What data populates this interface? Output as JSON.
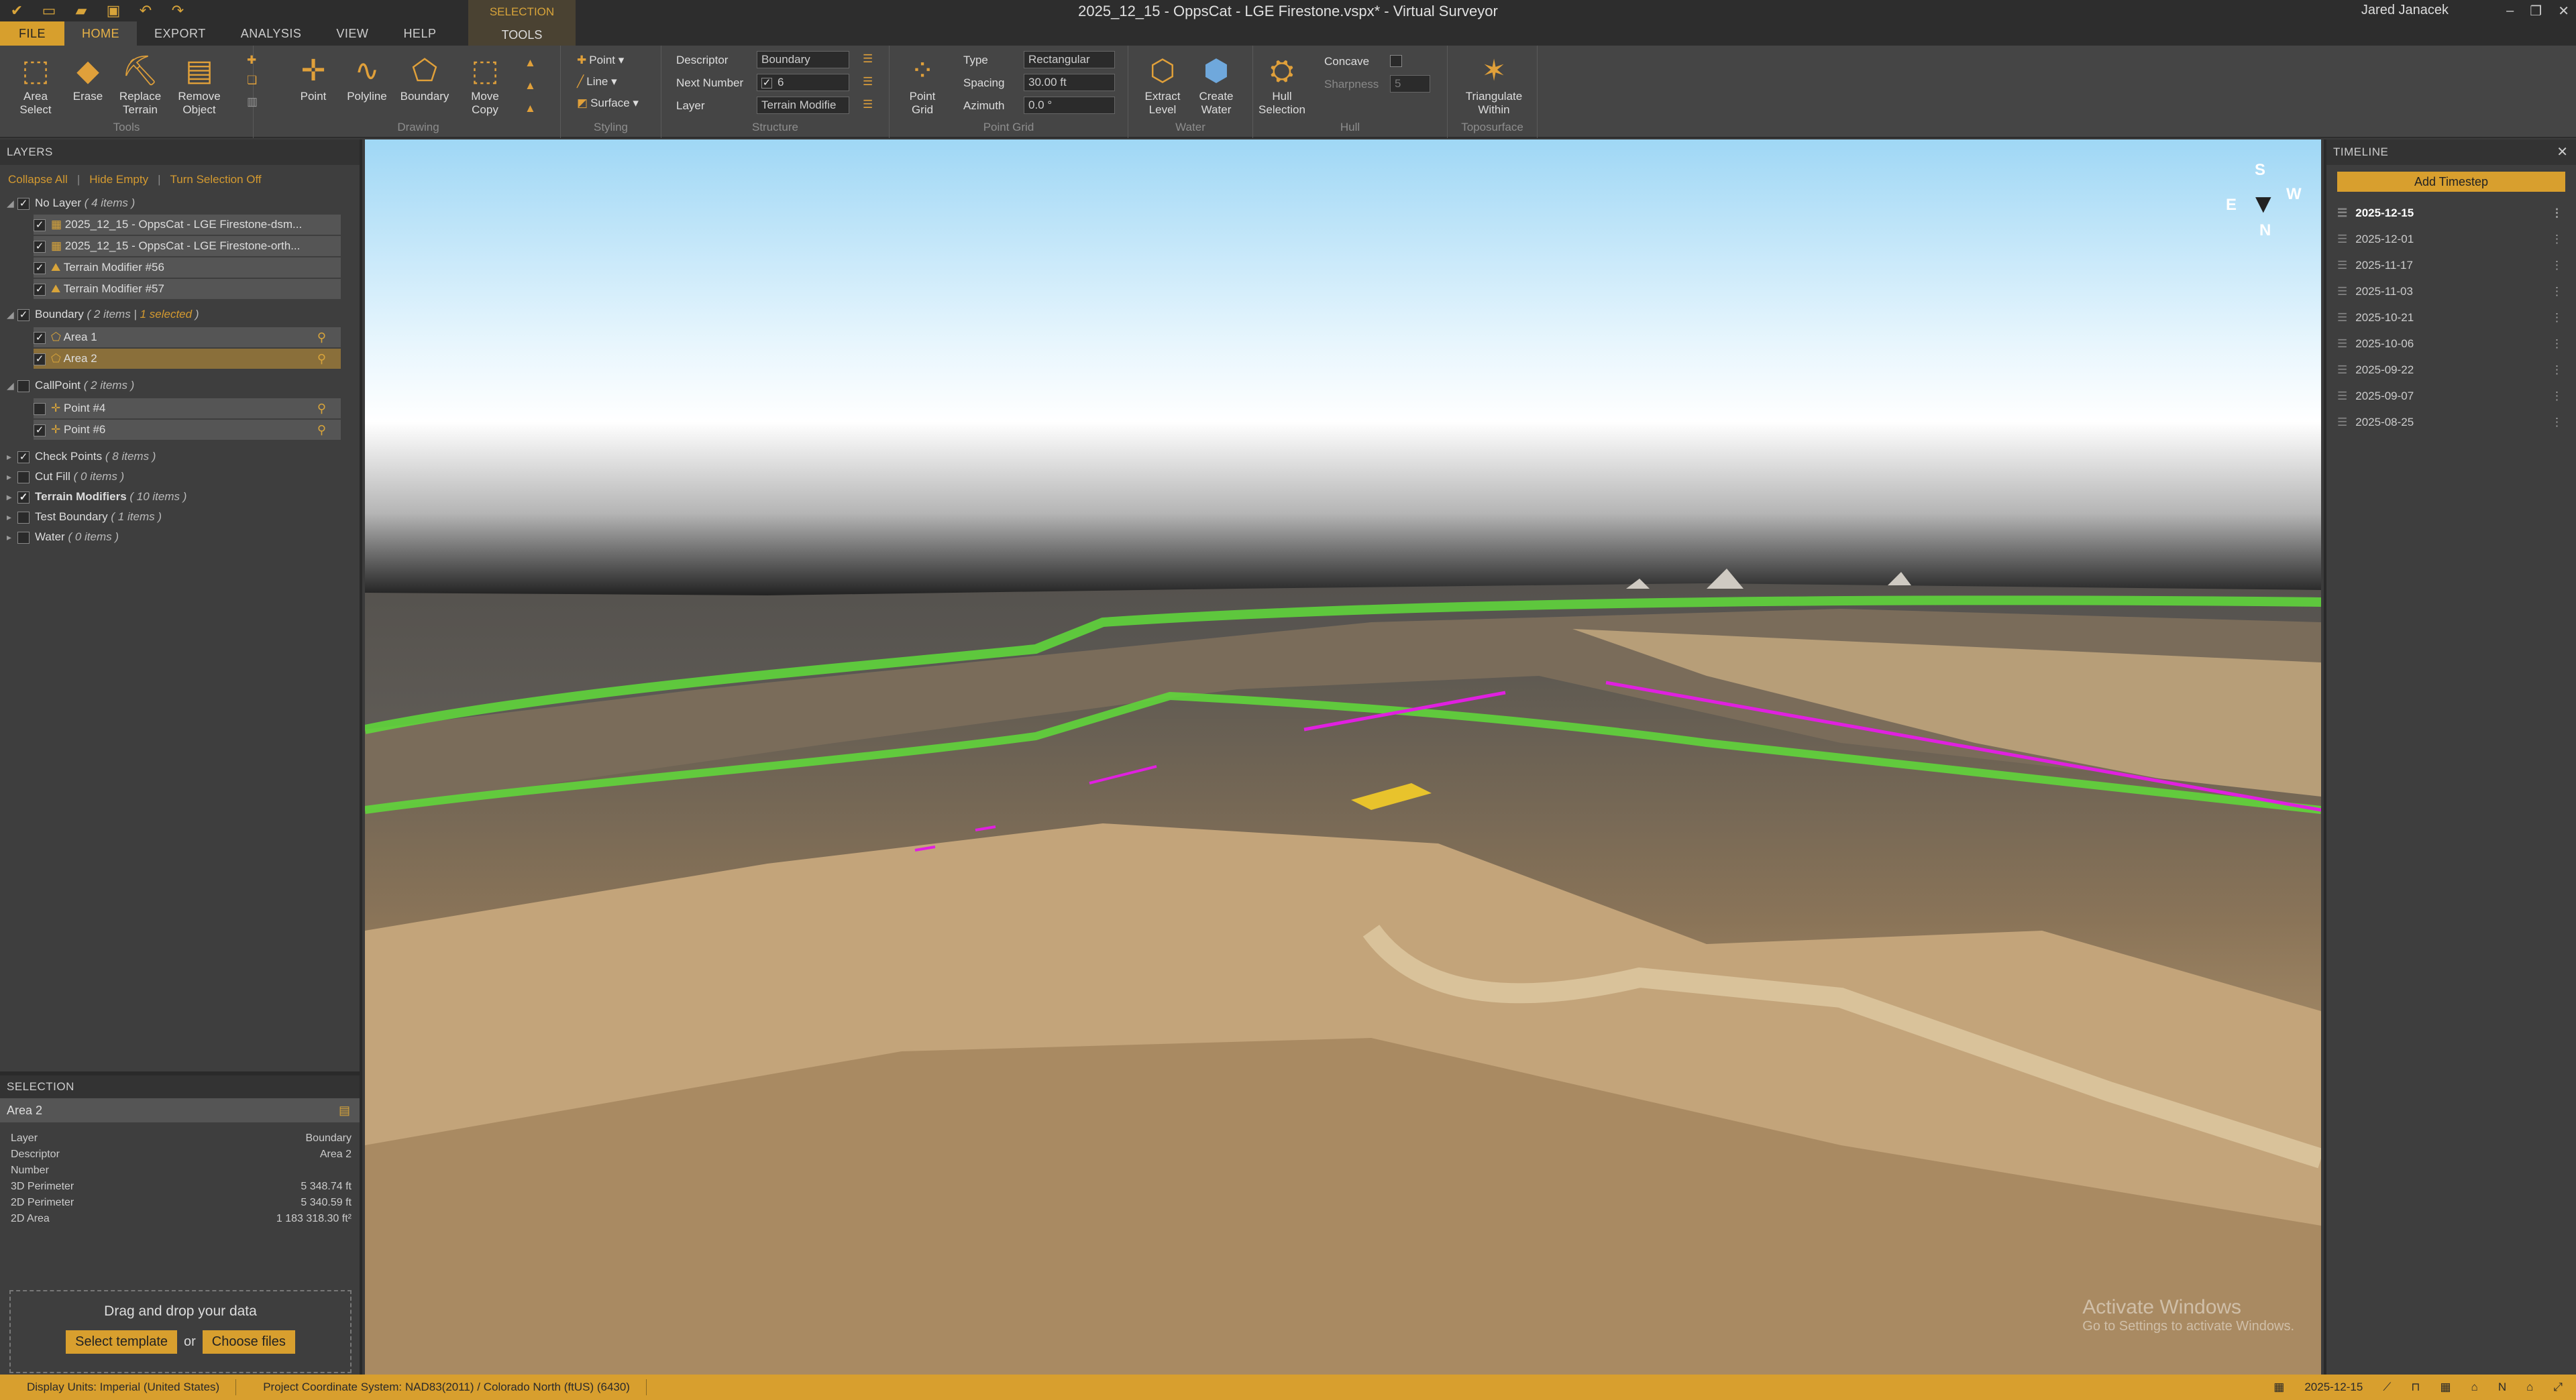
{
  "window": {
    "title": "2025_12_15 - OppsCat - LGE Firestone.vspx* - Virtual Surveyor",
    "user": "Jared Janacek"
  },
  "menu": {
    "tabs": [
      "FILE",
      "HOME",
      "EXPORT",
      "ANALYSIS",
      "VIEW",
      "HELP"
    ],
    "context_group": "SELECTION",
    "context_tab": "TOOLS"
  },
  "ribbon": {
    "tools": {
      "label": "Tools",
      "area_select": "Area\nSelect",
      "erase": "Erase",
      "replace_terrain": "Replace\nTerrain",
      "remove_object": "Remove\nObject"
    },
    "drawing": {
      "label": "Drawing",
      "point": "Point",
      "polyline": "Polyline",
      "boundary": "Boundary",
      "move_copy": "Move\nCopy"
    },
    "styling": {
      "label": "Styling",
      "point": "Point",
      "line": "Line",
      "surface": "Surface"
    },
    "structure": {
      "label": "Structure",
      "descriptor_label": "Descriptor",
      "descriptor_value": "Boundary",
      "next_number_label": "Next Number",
      "next_number_value": "6",
      "layer_label": "Layer",
      "layer_value": "Terrain Modifie"
    },
    "point_grid": {
      "label": "Point Grid",
      "button": "Point\nGrid",
      "type_label": "Type",
      "type_value": "Rectangular",
      "spacing_label": "Spacing",
      "spacing_value": "30.00 ft",
      "azimuth_label": "Azimuth",
      "azimuth_value": "0.0 °"
    },
    "water": {
      "label": "Water",
      "extract_level": "Extract\nLevel",
      "create_water": "Create\nWater"
    },
    "hull": {
      "label": "Hull",
      "hull_selection": "Hull\nSelection",
      "concave": "Concave",
      "sharpness_label": "Sharpness",
      "sharpness_value": "5"
    },
    "toposurface": {
      "label": "Toposurface",
      "triangulate": "Triangulate\nWithin"
    }
  },
  "layers": {
    "header": "LAYERS",
    "collapse_all": "Collapse All",
    "hide_empty": "Hide Empty",
    "turn_off": "Turn Selection Off",
    "groups": [
      {
        "name": "No Layer",
        "count": "( 4 items )",
        "children": [
          "2025_12_15 - OppsCat - LGE Firestone-dsm...",
          "2025_12_15 - OppsCat - LGE Firestone-orth...",
          "Terrain Modifier #56",
          "Terrain Modifier #57"
        ]
      },
      {
        "name": "Boundary",
        "count": "( 2 items |",
        "selected": "1 selected",
        "close": ")",
        "children": [
          "Area 1",
          "Area 2"
        ]
      },
      {
        "name": "CallPoint",
        "count": "( 2 items )",
        "children": [
          "Point #4",
          "Point #6"
        ]
      },
      {
        "name": "Check Points",
        "count": "( 8 items )"
      },
      {
        "name": "Cut Fill",
        "count": "( 0 items )"
      },
      {
        "name": "Terrain Modifiers",
        "count": "( 10 items )"
      },
      {
        "name": "Test Boundary",
        "count": "( 1 items )"
      },
      {
        "name": "Water",
        "count": "( 0 items )"
      }
    ]
  },
  "selection": {
    "header": "SELECTION",
    "name": "Area 2",
    "props": [
      {
        "k": "Layer",
        "v": "Boundary"
      },
      {
        "k": "Descriptor",
        "v": "Area 2"
      },
      {
        "k": "Number",
        "v": ""
      },
      {
        "k": "3D Perimeter",
        "v": "5 348.74 ft"
      },
      {
        "k": "2D Perimeter",
        "v": "5 340.59 ft"
      },
      {
        "k": "2D Area",
        "v": "1 183 318.30 ft²"
      }
    ],
    "drop_text": "Drag and drop your data",
    "select_template": "Select template",
    "or": "or",
    "choose_files": "Choose files"
  },
  "compass": {
    "s": "S",
    "w": "W",
    "e": "E",
    "n": "N"
  },
  "timeline": {
    "header": "TIMELINE",
    "add": "Add Timestep",
    "steps": [
      "2025-12-15",
      "2025-12-01",
      "2025-11-17",
      "2025-11-03",
      "2025-10-21",
      "2025-10-06",
      "2025-09-22",
      "2025-09-07",
      "2025-08-25"
    ]
  },
  "watermark": {
    "a": "Activate Windows",
    "b": "Go to Settings to activate Windows."
  },
  "status": {
    "units": "Display Units:  Imperial (United States)",
    "crs": "Project Coordinate System:  NAD83(2011) / Colorado North (ftUS) (6430)",
    "date": "2025-12-15"
  }
}
